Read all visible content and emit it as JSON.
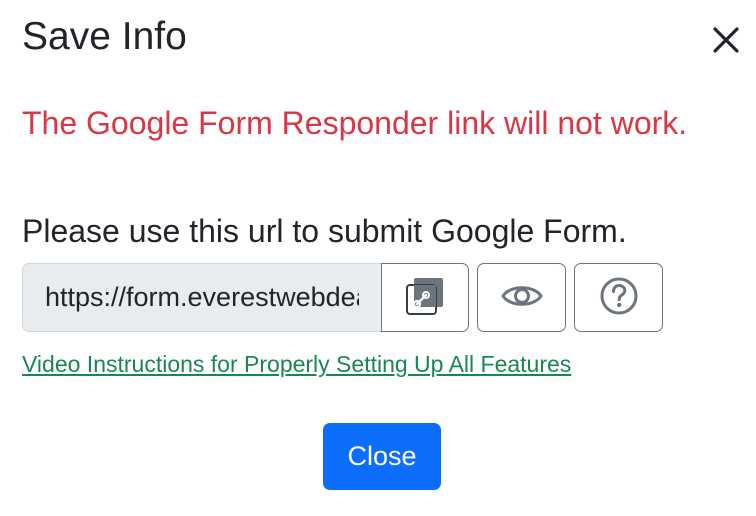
{
  "dialog": {
    "title": "Save Info",
    "close_icon": "close-icon"
  },
  "warning_text": "The Google Form Responder link will not work.",
  "instruction_text": "Please use this url to submit Google Form.",
  "url_field": {
    "value": "https://form.everestwebdeals.co"
  },
  "buttons": {
    "copy_icon": "copy-link-icon",
    "view_icon": "eye-icon",
    "help_icon": "question-circle-icon"
  },
  "video_link": "Video Instructions for Properly Setting Up All Features",
  "close_button_label": "Close",
  "colors": {
    "danger": "#dc3545",
    "primary": "#0d6efd",
    "link_green": "#198754",
    "input_bg": "#e9ecef"
  }
}
